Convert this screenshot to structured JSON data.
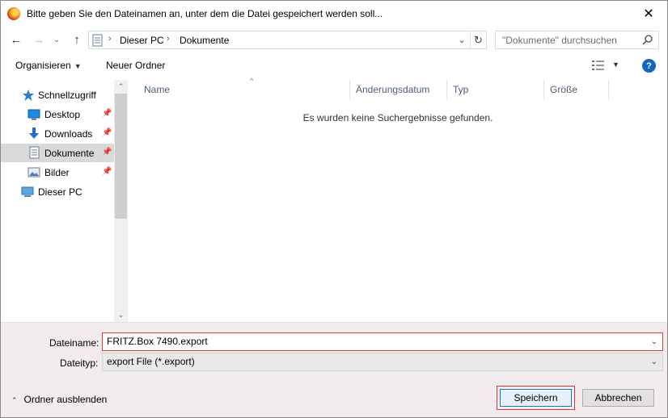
{
  "window": {
    "title": "Bitte geben Sie den Dateinamen an, unter dem die Datei gespeichert werden soll...",
    "close_label": "✕"
  },
  "navbar": {
    "back": "←",
    "forward": "→",
    "recent": "⌄",
    "up": "↑",
    "path": [
      "Dieser PC",
      "Dokumente"
    ],
    "separator": "›",
    "dropdown": "⌄",
    "refresh": "↻",
    "search_placeholder": "\"Dokumente\" durchsuchen"
  },
  "toolbar": {
    "organize_label": "Organisieren",
    "organize_caret": "▼",
    "new_folder_label": "Neuer Ordner",
    "view_caret": "▼",
    "help_label": "?"
  },
  "sidebar": {
    "items": [
      {
        "label": "Schnellzugriff",
        "icon": "star-icon",
        "pinned": false
      },
      {
        "label": "Desktop",
        "icon": "desktop-icon",
        "pinned": true
      },
      {
        "label": "Downloads",
        "icon": "download-icon",
        "pinned": true
      },
      {
        "label": "Dokumente",
        "icon": "document-icon",
        "pinned": true,
        "selected": true
      },
      {
        "label": "Bilder",
        "icon": "pictures-icon",
        "pinned": true
      },
      {
        "label": "Dieser PC",
        "icon": "computer-icon",
        "pinned": false
      }
    ],
    "pin_glyph": "📌",
    "scroll_up": "⌃",
    "scroll_down": "⌄"
  },
  "filelist": {
    "columns": [
      "Name",
      "Änderungsdatum",
      "Typ",
      "Größe"
    ],
    "sort_indicator": "^",
    "empty_message": "Es wurden keine Suchergebnisse gefunden."
  },
  "footer": {
    "filename_label": "Dateiname:",
    "filename_value": "FRITZ.Box 7490.export",
    "filetype_label": "Dateityp:",
    "filetype_value": "export File (*.export)",
    "dropdown_glyph": "⌄",
    "hide_folders_caret": "⌃",
    "hide_folders_label": "Ordner ausblenden",
    "save_label": "Speichern",
    "cancel_label": "Abbrechen"
  },
  "colors": {
    "accent": "#0078d7",
    "highlight_red": "#e0393e",
    "selected_bg": "#d9d9d9",
    "footer_bg": "#f3ecee",
    "help_blue": "#1565c0"
  }
}
